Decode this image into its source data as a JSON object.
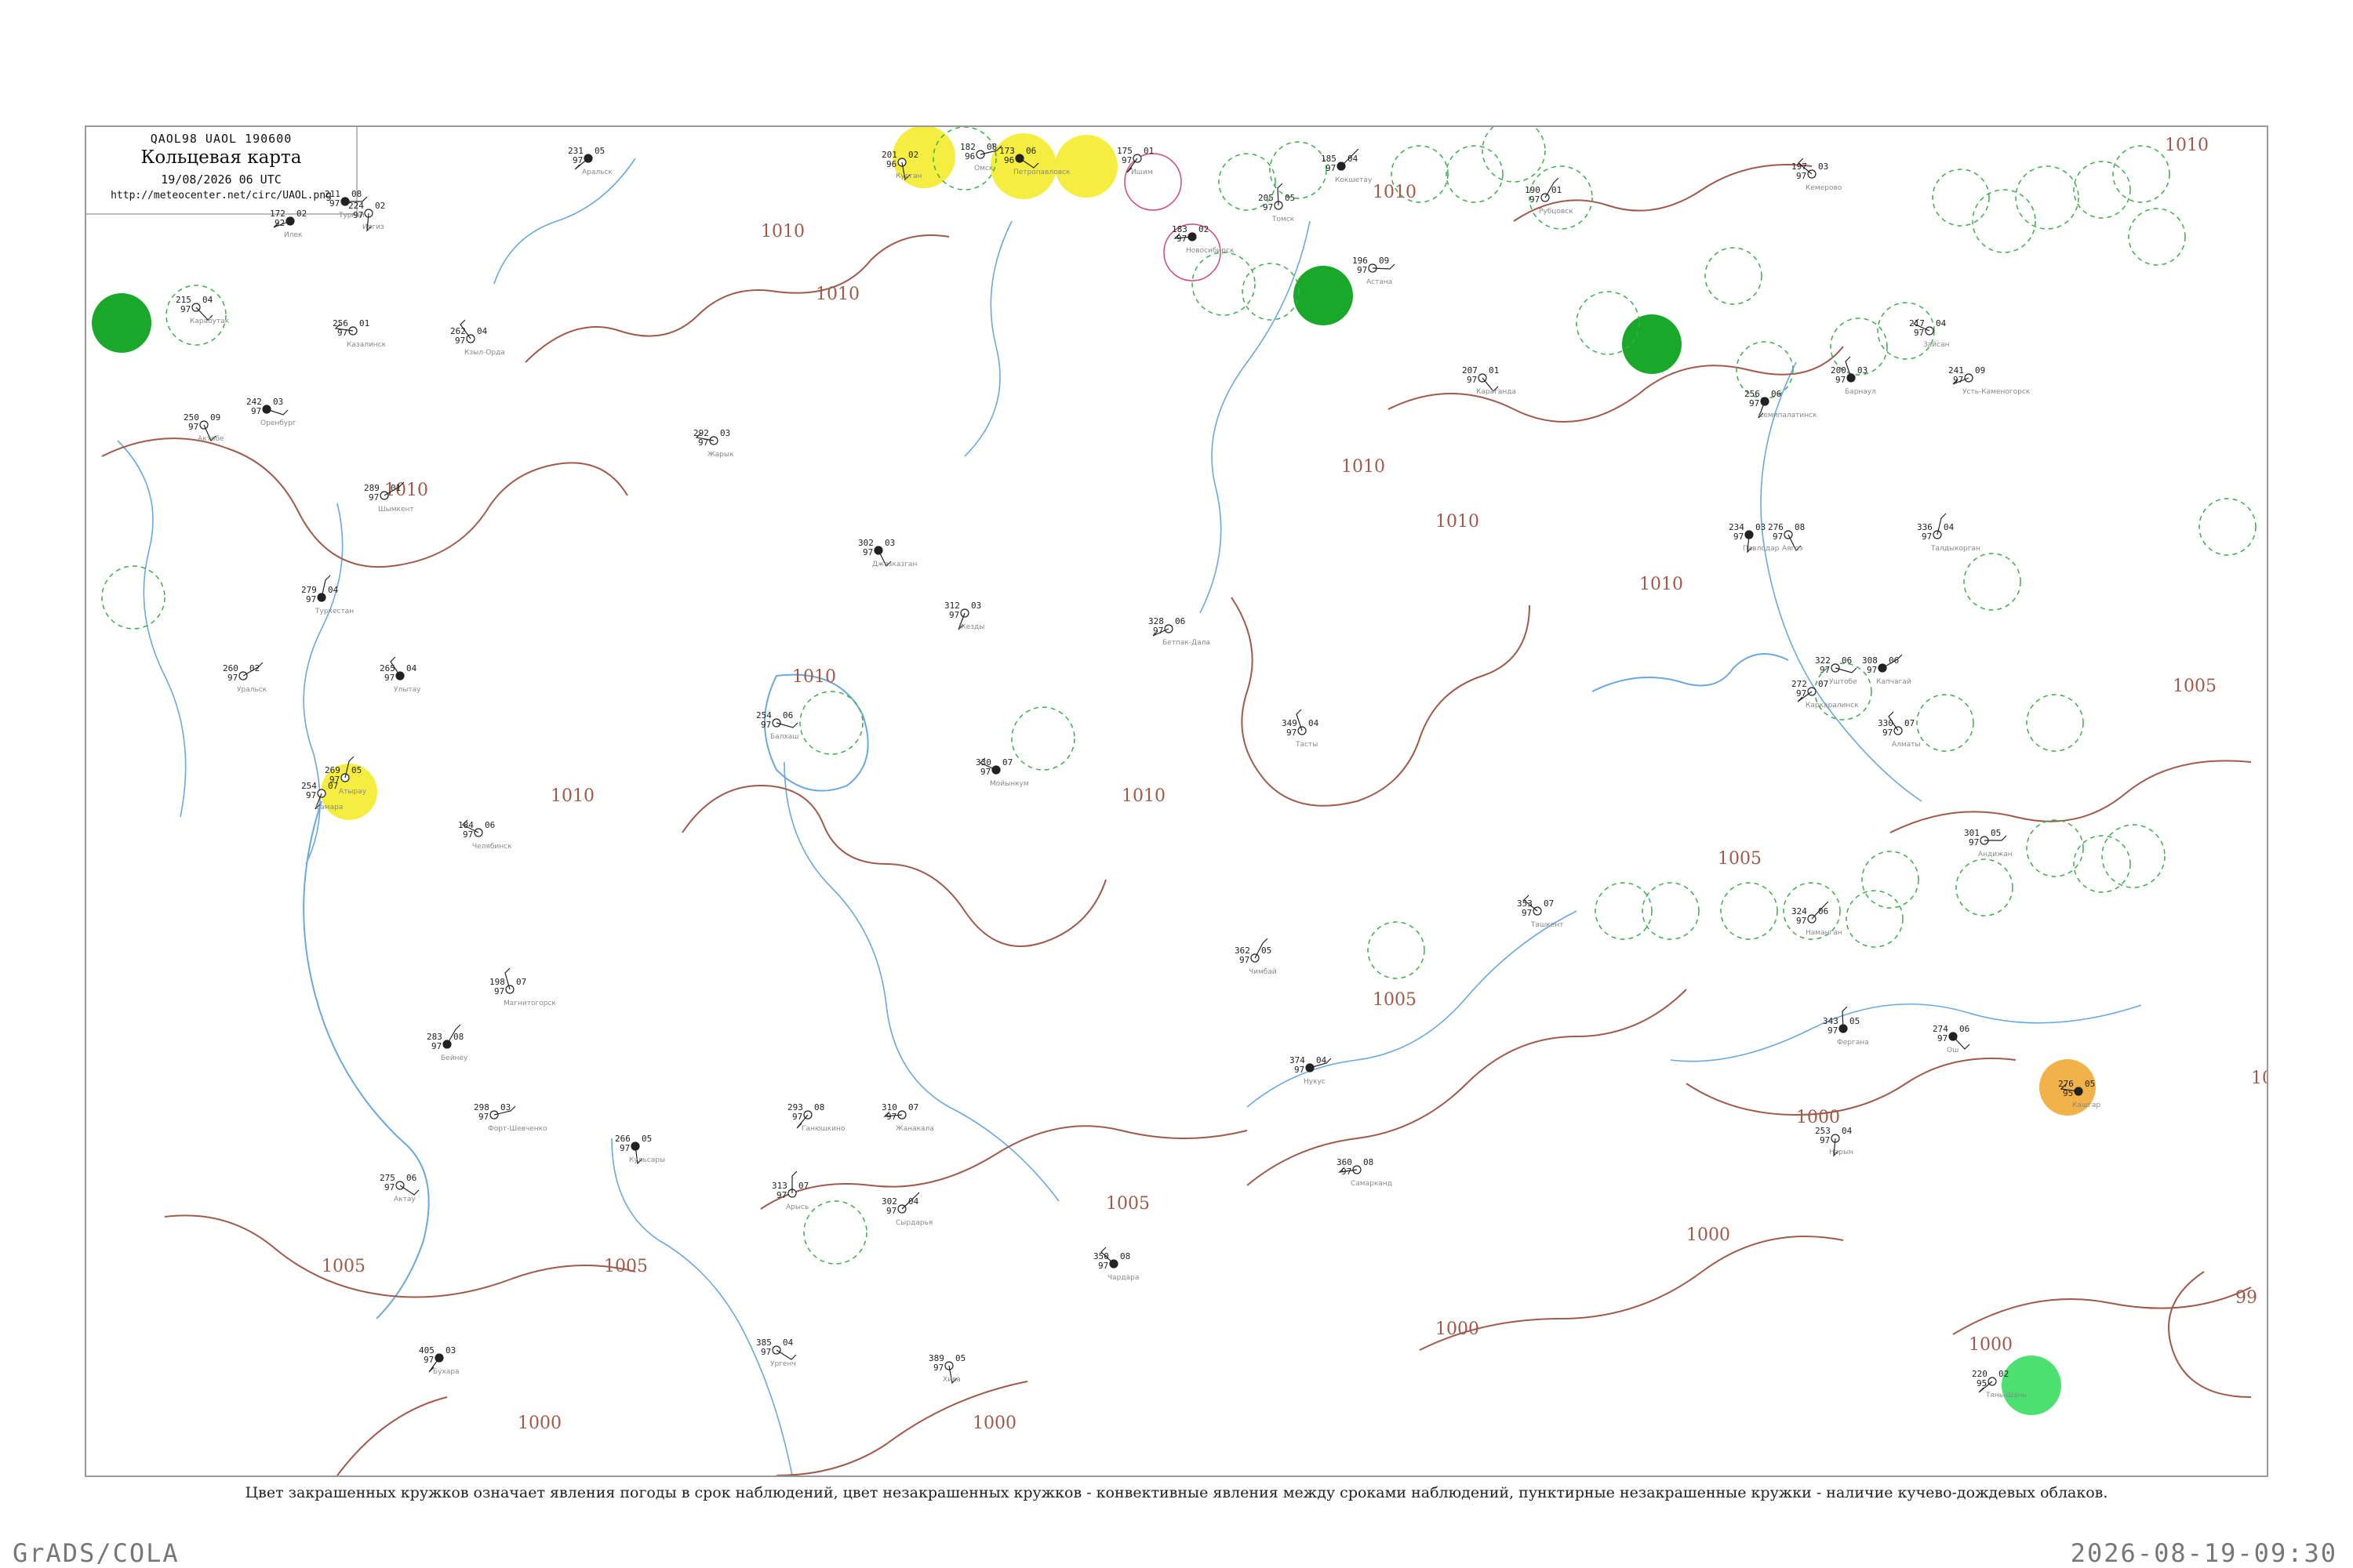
{
  "header": {
    "code_line": "QAOL98  UAOL  190600",
    "title": "Кольцевая карта",
    "date_line": "19/08/2026 06 UTC",
    "url": "http://meteocenter.net/circ/UAOL.png"
  },
  "caption": "Цвет закрашенных кружков означает явления погоды в срок наблюдений, цвет незакрашенных кружков - конвективные явления между сроками наблюдений, пунктирные незакрашенные кружки - наличие кучево-дождевых облаков.",
  "footer": {
    "left": "GrADS/COLA",
    "right": "2026-08-19-09:30"
  },
  "isobar_labels": [
    "1010",
    "1010",
    "1010",
    "1010",
    "1010",
    "1010",
    "1010",
    "1010",
    "1010",
    "1010",
    "1010",
    "1005",
    "1005",
    "1005",
    "1005",
    "1005",
    "1005",
    "1000",
    "1000",
    "1000",
    "1000",
    "1000",
    "1000",
    "99",
    "10"
  ],
  "colors": {
    "isobar": "#a05a4a",
    "river": "#6aa8e0",
    "cb_circle": "#3ab04a",
    "rain_fill": "#1aa82a",
    "shower_fill": "#4be070",
    "haze_fill": "#f5ee40",
    "dust_fill": "#f2b24a",
    "thunder_circle": "#d04a7a"
  },
  "stations": [
    {
      "temp": "211",
      "dew": "97",
      "pres": "08",
      "name": "Тургай"
    },
    {
      "temp": "215",
      "dew": "97",
      "pres": "04",
      "name": "Карабутак"
    },
    {
      "temp": "224",
      "dew": "97",
      "pres": "02",
      "name": "Иргиз"
    },
    {
      "temp": "231",
      "dew": "97",
      "pres": "05",
      "name": "Аральск"
    },
    {
      "temp": "256",
      "dew": "97",
      "pres": "01",
      "name": "Казалинск"
    },
    {
      "temp": "262",
      "dew": "97",
      "pres": "04",
      "name": "Кзыл-Орда"
    },
    {
      "temp": "279",
      "dew": "97",
      "pres": "04",
      "name": "Туркестан"
    },
    {
      "temp": "289",
      "dew": "97",
      "pres": "01",
      "name": "Шымкент"
    },
    {
      "temp": "254",
      "dew": "97",
      "pres": "06",
      "name": "Балхаш"
    },
    {
      "temp": "302",
      "dew": "97",
      "pres": "03",
      "name": "Джезказган"
    },
    {
      "temp": "312",
      "dew": "97",
      "pres": "03",
      "name": "Жезды"
    },
    {
      "temp": "328",
      "dew": "97",
      "pres": "06",
      "name": "Бетпак-Дала"
    },
    {
      "temp": "330",
      "dew": "97",
      "pres": "07",
      "name": "Мойынкум"
    },
    {
      "temp": "349",
      "dew": "97",
      "pres": "04",
      "name": "Тасты"
    },
    {
      "temp": "362",
      "dew": "97",
      "pres": "05",
      "name": "Чимбай"
    },
    {
      "temp": "374",
      "dew": "97",
      "pres": "04",
      "name": "Нукус"
    },
    {
      "temp": "385",
      "dew": "97",
      "pres": "04",
      "name": "Ургенч"
    },
    {
      "temp": "389",
      "dew": "97",
      "pres": "05",
      "name": "Хива"
    },
    {
      "temp": "405",
      "dew": "97",
      "pres": "03",
      "name": "Бухара"
    },
    {
      "temp": "360",
      "dew": "97",
      "pres": "08",
      "name": "Самарканд"
    },
    {
      "temp": "353",
      "dew": "97",
      "pres": "07",
      "name": "Ташкент"
    },
    {
      "temp": "343",
      "dew": "97",
      "pres": "05",
      "name": "Фергана"
    },
    {
      "temp": "324",
      "dew": "97",
      "pres": "06",
      "name": "Наманган"
    },
    {
      "temp": "301",
      "dew": "97",
      "pres": "05",
      "name": "Андижан"
    },
    {
      "temp": "274",
      "dew": "97",
      "pres": "06",
      "name": "Ош"
    },
    {
      "temp": "253",
      "dew": "97",
      "pres": "04",
      "name": "Нарын"
    },
    {
      "temp": "220",
      "dew": "95",
      "pres": "02",
      "name": "Тянь-Шань"
    },
    {
      "temp": "276",
      "dew": "95",
      "pres": "05",
      "name": "Кашгар"
    },
    {
      "temp": "330",
      "dew": "97",
      "pres": "07",
      "name": "Алматы"
    },
    {
      "temp": "336",
      "dew": "97",
      "pres": "04",
      "name": "Талдыкорган"
    },
    {
      "temp": "308",
      "dew": "97",
      "pres": "06",
      "name": "Капчагай"
    },
    {
      "temp": "322",
      "dew": "97",
      "pres": "06",
      "name": "Уштобе"
    },
    {
      "temp": "276",
      "dew": "97",
      "pres": "08",
      "name": "Аягоз"
    },
    {
      "temp": "256",
      "dew": "97",
      "pres": "06",
      "name": "Семипалатинск"
    },
    {
      "temp": "241",
      "dew": "97",
      "pres": "09",
      "name": "Усть-Каменогорск"
    },
    {
      "temp": "217",
      "dew": "97",
      "pres": "04",
      "name": "Зайсан"
    },
    {
      "temp": "200",
      "dew": "97",
      "pres": "03",
      "name": "Барнаул"
    },
    {
      "temp": "190",
      "dew": "97",
      "pres": "01",
      "name": "Рубцовск"
    },
    {
      "temp": "182",
      "dew": "96",
      "pres": "08",
      "name": "Омск"
    },
    {
      "temp": "173",
      "dew": "96",
      "pres": "06",
      "name": "Петропавловск"
    },
    {
      "temp": "201",
      "dew": "96",
      "pres": "02",
      "name": "Курган"
    },
    {
      "temp": "175",
      "dew": "97",
      "pres": "01",
      "name": "Ишим"
    },
    {
      "temp": "183",
      "dew": "97",
      "pres": "02",
      "name": "Новосибирск"
    },
    {
      "temp": "197",
      "dew": "97",
      "pres": "03",
      "name": "Кемерово"
    },
    {
      "temp": "205",
      "dew": "97",
      "pres": "05",
      "name": "Томск"
    },
    {
      "temp": "185",
      "dew": "97",
      "pres": "04",
      "name": "Кокшетау"
    },
    {
      "temp": "196",
      "dew": "97",
      "pres": "09",
      "name": "Астана"
    },
    {
      "temp": "207",
      "dew": "97",
      "pres": "01",
      "name": "Караганда"
    },
    {
      "temp": "234",
      "dew": "97",
      "pres": "03",
      "name": "Павлодар"
    },
    {
      "temp": "272",
      "dew": "97",
      "pres": "07",
      "name": "Каркаралинск"
    },
    {
      "temp": "292",
      "dew": "97",
      "pres": "03",
      "name": "Жарык"
    },
    {
      "temp": "265",
      "dew": "97",
      "pres": "04",
      "name": "Улытау"
    },
    {
      "temp": "269",
      "dew": "97",
      "pres": "05",
      "name": "Атырау"
    },
    {
      "temp": "260",
      "dew": "97",
      "pres": "02",
      "name": "Уральск"
    },
    {
      "temp": "242",
      "dew": "97",
      "pres": "03",
      "name": "Оренбург"
    },
    {
      "temp": "250",
      "dew": "97",
      "pres": "09",
      "name": "Актобе"
    },
    {
      "temp": "254",
      "dew": "97",
      "pres": "07",
      "name": "Самара"
    },
    {
      "temp": "172",
      "dew": "92",
      "pres": "02",
      "name": "Илек"
    },
    {
      "temp": "184",
      "dew": "97",
      "pres": "06",
      "name": "Челябинск"
    },
    {
      "temp": "198",
      "dew": "97",
      "pres": "07",
      "name": "Магнитогорск"
    },
    {
      "temp": "283",
      "dew": "97",
      "pres": "08",
      "name": "Бейнеу"
    },
    {
      "temp": "298",
      "dew": "97",
      "pres": "03",
      "name": "Форт-Шевченко"
    },
    {
      "temp": "275",
      "dew": "97",
      "pres": "06",
      "name": "Актау"
    },
    {
      "temp": "266",
      "dew": "97",
      "pres": "05",
      "name": "Кульсары"
    },
    {
      "temp": "293",
      "dew": "97",
      "pres": "08",
      "name": "Ганюшкино"
    },
    {
      "temp": "310",
      "dew": "97",
      "pres": "07",
      "name": "Жанакала"
    },
    {
      "temp": "350",
      "dew": "97",
      "pres": "08",
      "name": "Чардара"
    },
    {
      "temp": "313",
      "dew": "97",
      "pres": "07",
      "name": "Арысь"
    },
    {
      "temp": "302",
      "dew": "97",
      "pres": "04",
      "name": "Сырдарья"
    }
  ]
}
